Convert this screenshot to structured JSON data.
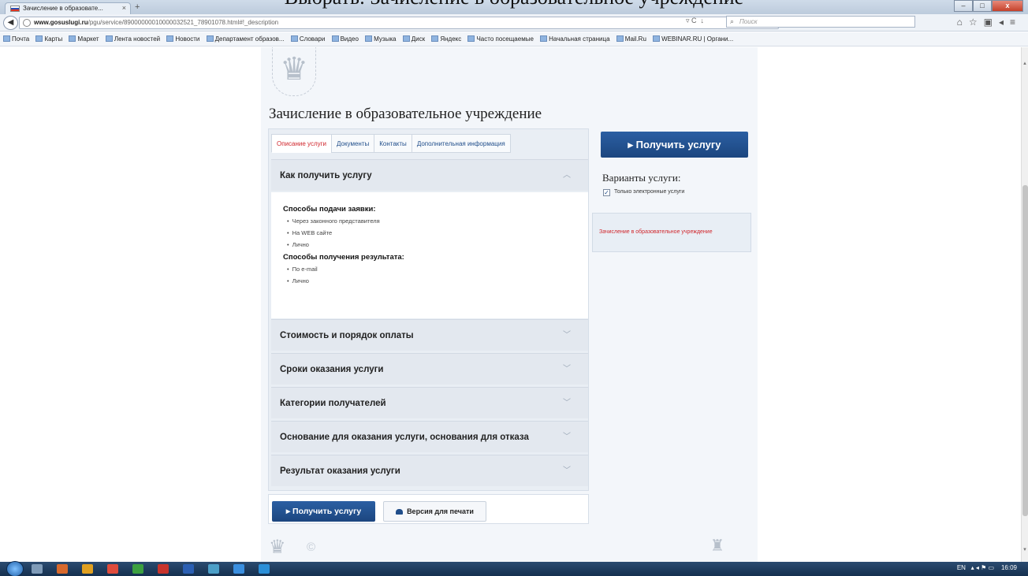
{
  "caption": "Выбрать: Зачисление в образовательное учреждение",
  "browser": {
    "tab_title": "Зачисление в образовате...",
    "tab_close": "×",
    "new_tab": "+",
    "url_host": "www.gosuslugi.ru",
    "url_path": "/pgu/service/89000000010000032521_78901078.html#!_description",
    "search_placeholder": "Поиск",
    "bookmarks": [
      "Почта",
      "Карты",
      "Маркет",
      "Лента новостей",
      "Новости",
      "Департамент образов...",
      "Словари",
      "Видео",
      "Музыка",
      "Диск",
      "Яндекс",
      "Часто посещаемые",
      "Начальная страница",
      "Mail.Ru",
      "WEBINAR.RU | Органи..."
    ]
  },
  "page": {
    "title": "Зачисление в образовательное учреждение",
    "tabs": [
      {
        "label": "Описание услуги",
        "active": true
      },
      {
        "label": "Документы",
        "active": false
      },
      {
        "label": "Контакты",
        "active": false
      },
      {
        "label": "Дополнительная информация",
        "active": false
      }
    ],
    "accordion_open": {
      "title": "Как получить услугу",
      "sections": [
        {
          "heading": "Способы подачи заявки:",
          "items": [
            "Через законного представителя",
            "На WEB сайте",
            "Лично"
          ]
        },
        {
          "heading": "Способы получения результата:",
          "items": [
            "По e-mail",
            "Лично"
          ]
        }
      ]
    },
    "accordion_closed": [
      "Стоимость и порядок оплаты",
      "Сроки оказания услуги",
      "Категории получателей",
      "Основание для оказания услуги, основания для отказа",
      "Результат оказания услуги"
    ],
    "get_service": "▸  Получить услугу",
    "print_version": "Версия для печати",
    "variants_title": "Варианты услуги:",
    "only_electronic": "Только электронные услуги",
    "side_link": "Зачисление в образовательное учреждение"
  },
  "taskbar": {
    "lang": "EN",
    "time": "16:09"
  }
}
